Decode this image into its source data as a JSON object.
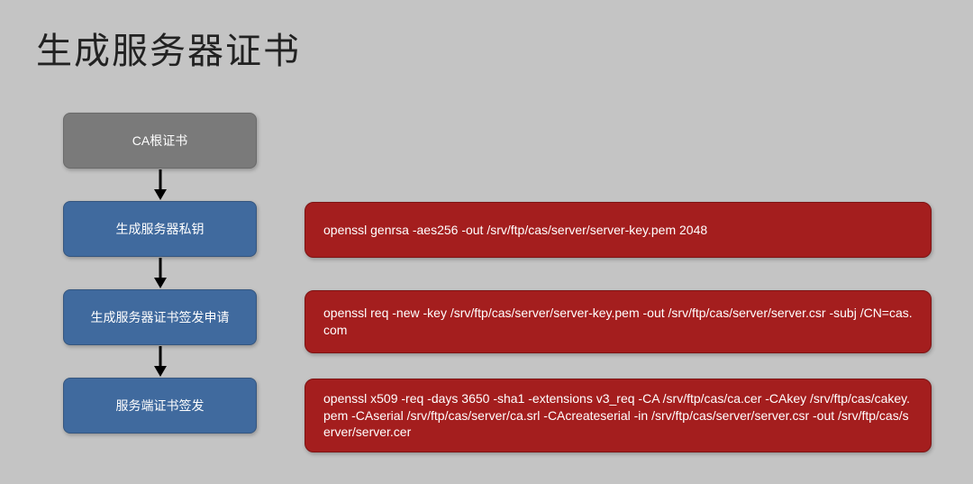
{
  "title": "生成服务器证书",
  "flow": {
    "n0": "CA根证书",
    "n1": "生成服务器私钥",
    "n2": "生成服务器证书签发申请",
    "n3": "服务端证书签发"
  },
  "cmds": {
    "c1": "openssl genrsa -aes256 -out /srv/ftp/cas/server/server-key.pem 2048",
    "c2": "openssl req -new -key /srv/ftp/cas/server/server-key.pem -out /srv/ftp/cas/server/server.csr -subj /CN=cas.com",
    "c3": "openssl x509 -req -days 3650 -sha1 -extensions v3_req -CA /srv/ftp/cas/ca.cer -CAkey /srv/ftp/cas/cakey.pem -CAserial /srv/ftp/cas/server/ca.srl -CAcreateserial -in /srv/ftp/cas/server/server.csr -out /srv/ftp/cas/server/server.cer"
  },
  "colors": {
    "bg": "#c4c4c4",
    "gray": "#7a7a7a",
    "blue": "#406a9e",
    "red": "#a41e1e"
  }
}
